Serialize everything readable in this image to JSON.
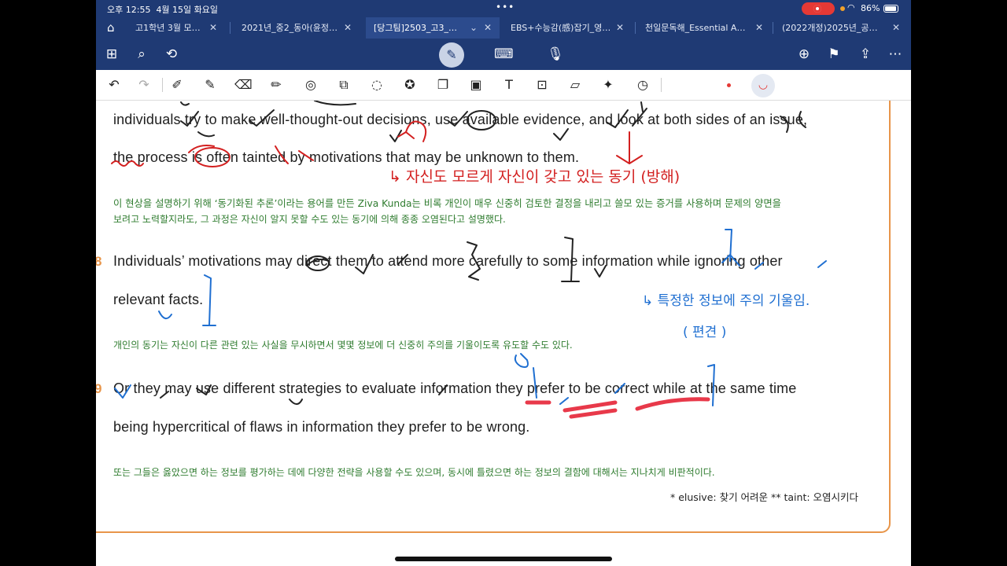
{
  "status": {
    "time": "오후 12:55",
    "date": "4월 15일 화요일",
    "battery": "86%"
  },
  "tabs": [
    {
      "label": "고1학년 3월 모…"
    },
    {
      "label": "2021년_중2_동아(윤정…"
    },
    {
      "label": "[당그팀]2503_고3_…"
    },
    {
      "label": "EBS+수능감(感)잡기_영…"
    },
    {
      "label": "천일문독해_Essential A…"
    },
    {
      "label": "(2022개정)2025년_공…"
    }
  ],
  "toolbar1": {
    "left_icons": [
      "grid-icon",
      "search-icon",
      "lasso-icon"
    ],
    "center_icons": [
      "pen-icon",
      "keyboard-icon",
      "mic-icon"
    ],
    "right_icons": [
      "add-page-icon",
      "bookmark-icon",
      "share-icon",
      "more-icon"
    ]
  },
  "toolbar2": {
    "icons": [
      "undo-icon",
      "redo-icon",
      "pencil-icon",
      "pen-icon",
      "eraser-icon",
      "highlighter-icon",
      "shape-icon",
      "sticker-icon",
      "lasso-icon",
      "star-icon",
      "copy-icon",
      "image-icon",
      "text-icon",
      "scan-icon",
      "ruler-icon",
      "laser-icon",
      "timer-icon"
    ]
  },
  "document": {
    "line_a": "individuals try to make well-thought-out decisions, use available evidence, and look at both sides of an issue,",
    "line_b": "the process is often tainted by motivations that may be unknown to them.",
    "ko_1a": "이 현상을 설명하기 위해 ‘동기화된 추론’이라는 용어를 만든 Ziva Kunda는 비록 개인이 매우 신중히 검토한 결정을 내리고 쓸모 있는 증거를 사용하며 문제의 양면을",
    "ko_1b": "보려고 노력할지라도, 그 과정은 자신이 알지 못할 수도 있는 동기에 의해 종종 오염된다고 설명했다.",
    "num_8": "8",
    "line_8a": "Individuals’ motivations may direct them to attend more carefully to some information while ignoring other",
    "line_8b": "relevant facts.",
    "ko_8": "개인의 동기는 자신이 다른 관련 있는 사실을 무시하면서 몇몇 정보에 더 신중히 주의를 기울이도록 유도할 수도 있다.",
    "num_9": "9",
    "line_9a": "Or they may use different strategies to evaluate information they prefer to be correct while at the same time",
    "line_9b": "being hypercritical of flaws in information they prefer to be wrong.",
    "ko_9": "또는 그들은 옳았으면 하는 정보를 평가하는 데에 다양한 전략을 사용할 수도 있으며, 동시에 틀렸으면 하는 정보의 결함에 대해서는 지나치게 비판적이다.",
    "footnote": "* elusive: 찾기 어려운 ** taint: 오염시키다"
  },
  "annotations": {
    "red_note": "↳ 자신도 모르게 자신이 갖고 있는 동기 (방해)",
    "blue_note_1": "↳ 특정한 정보에 주의 기울임.",
    "blue_note_2": "( 편견 )"
  }
}
